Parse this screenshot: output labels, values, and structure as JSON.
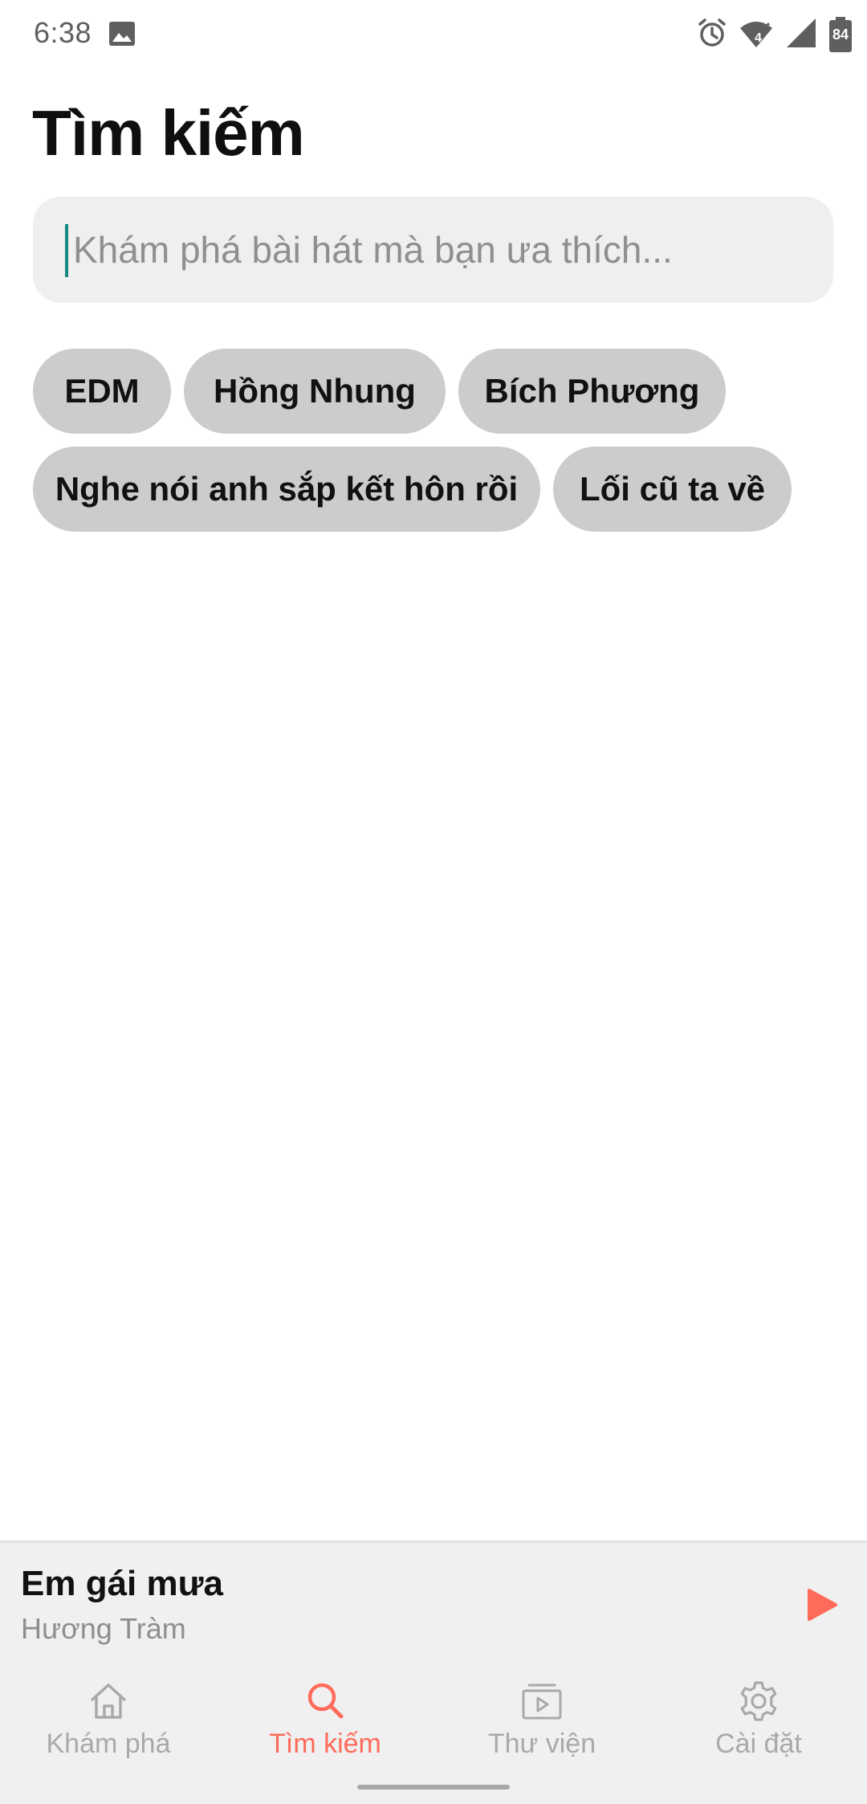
{
  "status_bar": {
    "time": "6:38",
    "battery": "84",
    "network_badge": "4",
    "icons": [
      "photo-icon",
      "alarm-icon",
      "wifi-icon",
      "signal-icon",
      "battery-icon"
    ]
  },
  "page": {
    "title": "Tìm kiếm"
  },
  "search": {
    "placeholder": "Khám phá bài hát mà bạn ưa thích...",
    "value": ""
  },
  "suggestions": [
    "EDM",
    "Hồng Nhung",
    "Bích Phương",
    "Nghe nói anh sắp kết hôn rồi",
    "Lối cũ ta về"
  ],
  "player": {
    "song_title": "Em gái mưa",
    "artist": "Hương Tràm",
    "play_icon": "play-icon"
  },
  "bottom_nav": {
    "active": "Tìm kiếm",
    "items": [
      {
        "label": "Khám phá",
        "icon": "home-icon"
      },
      {
        "label": "Tìm kiếm",
        "icon": "search-icon"
      },
      {
        "label": "Thư viện",
        "icon": "library-icon"
      },
      {
        "label": "Cài đặt",
        "icon": "gear-icon"
      }
    ]
  },
  "colors": {
    "accent": "#ff6b5a",
    "chip_bg": "#cccccc",
    "search_bg": "#efefef",
    "caret": "#15897f",
    "nav_inactive": "#a9a9a9",
    "bottom_bg": "#f0f0f0"
  }
}
